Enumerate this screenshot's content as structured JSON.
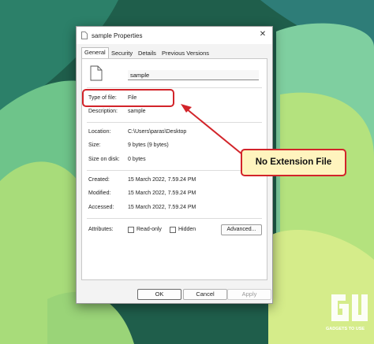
{
  "dialog": {
    "title": "sample Properties",
    "close_glyph": "✕",
    "tabs": [
      {
        "label": "General",
        "active": true
      },
      {
        "label": "Security",
        "active": false
      },
      {
        "label": "Details",
        "active": false
      },
      {
        "label": "Previous Versions",
        "active": false
      }
    ],
    "file_name": "sample",
    "rows": {
      "type_label": "Type of file:",
      "type_value": "File",
      "description_label": "Description:",
      "description_value": "sample",
      "location_label": "Location:",
      "location_value": "C:\\Users\\paras\\Desktop",
      "size_label": "Size:",
      "size_value": "9 bytes (9 bytes)",
      "size_on_disk_label": "Size on disk:",
      "size_on_disk_value": "0 bytes",
      "created_label": "Created:",
      "created_value": "15 March 2022, 7.59.24 PM",
      "modified_label": "Modified:",
      "modified_value": "15 March 2022, 7.59.24 PM",
      "accessed_label": "Accessed:",
      "accessed_value": "15 March 2022, 7.59.24 PM",
      "attributes_label": "Attributes:"
    },
    "attributes": {
      "readonly_label": "Read-only",
      "readonly_checked": false,
      "hidden_label": "Hidden",
      "hidden_checked": false,
      "advanced_label": "Advanced..."
    },
    "buttons": {
      "ok": "OK",
      "cancel": "Cancel",
      "apply": "Apply"
    }
  },
  "annotation": {
    "callout_text": "No Extension File",
    "color": "#d2242a",
    "callout_fill": "#fff4be"
  },
  "watermark": {
    "text": "GADGETS TO USE"
  },
  "icons": [
    "file-icon",
    "close-icon",
    "arrow-annotation",
    "gadgets-to-use-logo"
  ]
}
